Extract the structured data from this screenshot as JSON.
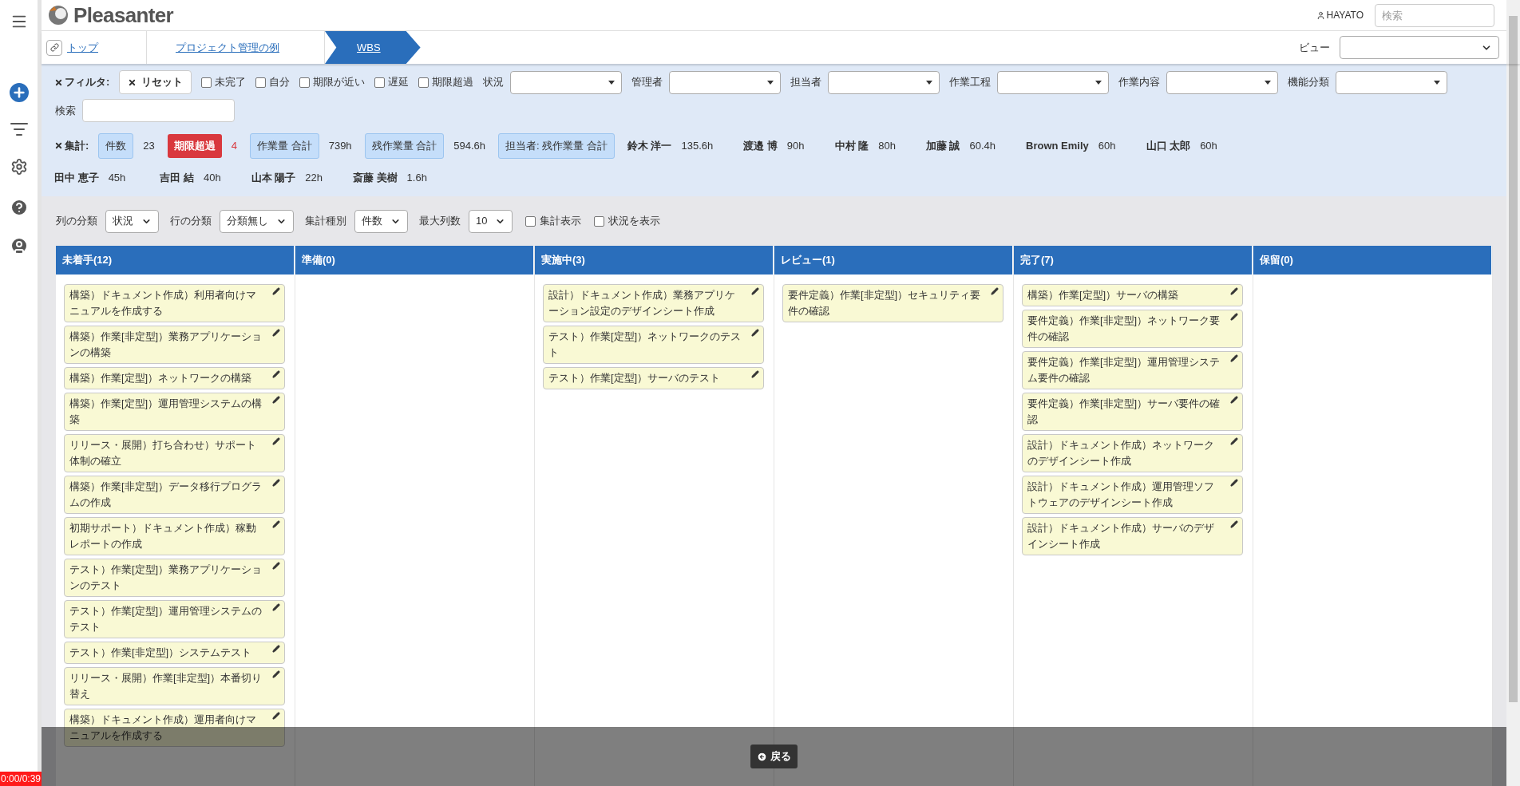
{
  "header": {
    "logo": "Pleasanter",
    "user": "HAYATO",
    "search_placeholder": "検索"
  },
  "breadcrumb": [
    {
      "label": "トップ",
      "selected": false
    },
    {
      "label": "プロジェクト管理の例",
      "selected": false
    },
    {
      "label": "WBS",
      "selected": true
    }
  ],
  "view": {
    "label": "ビュー"
  },
  "filters": {
    "label": "フィルタ:",
    "reset": "リセット",
    "checkboxes": [
      {
        "label": "未完了",
        "checked": false
      },
      {
        "label": "自分",
        "checked": false
      },
      {
        "label": "期限が近い",
        "checked": false
      },
      {
        "label": "遅延",
        "checked": false
      },
      {
        "label": "期限超過",
        "checked": false
      }
    ],
    "selects": [
      {
        "label": "状況"
      },
      {
        "label": "管理者"
      },
      {
        "label": "担当者"
      },
      {
        "label": "作業工程"
      },
      {
        "label": "作業内容"
      },
      {
        "label": "機能分類"
      }
    ],
    "search_label": "検索"
  },
  "summary": {
    "label": "集計:",
    "items": [
      {
        "kind": "chip",
        "label": "件数",
        "value": "23"
      },
      {
        "kind": "alert",
        "label": "期限超過",
        "value": "4"
      },
      {
        "kind": "chip",
        "label": "作業量 合計",
        "value": "739h"
      },
      {
        "kind": "chip",
        "label": "残作業量 合計",
        "value": "594.6h"
      },
      {
        "kind": "chip",
        "label": "担当者: 残作業量 合計"
      },
      {
        "kind": "person",
        "label": "鈴木 洋一",
        "value": "135.6h"
      },
      {
        "kind": "person",
        "label": "渡邉 博",
        "value": "90h"
      },
      {
        "kind": "person",
        "label": "中村 隆",
        "value": "80h"
      },
      {
        "kind": "person",
        "label": "加藤 誠",
        "value": "60.4h"
      },
      {
        "kind": "person",
        "label": "Brown Emily",
        "value": "60h"
      },
      {
        "kind": "person",
        "label": "山口 太郎",
        "value": "60h"
      },
      {
        "kind": "person",
        "label": "田中 恵子",
        "value": "45h"
      },
      {
        "kind": "person",
        "label": "吉田 結",
        "value": "40h"
      },
      {
        "kind": "person",
        "label": "山本 陽子",
        "value": "22h"
      },
      {
        "kind": "person",
        "label": "斎藤 美樹",
        "value": "1.6h"
      }
    ]
  },
  "options": [
    {
      "kind": "select",
      "label": "列の分類",
      "value": "状況"
    },
    {
      "kind": "select",
      "label": "行の分類",
      "value": "分類無し"
    },
    {
      "kind": "select",
      "label": "集計種別",
      "value": "件数"
    },
    {
      "kind": "select",
      "label": "最大列数",
      "value": "10"
    },
    {
      "kind": "checkbox",
      "label": "集計表示",
      "checked": false
    },
    {
      "kind": "checkbox",
      "label": "状況を表示",
      "checked": false
    }
  ],
  "columns": [
    {
      "title": "未着手(12)",
      "cards": [
        "構築）ドキュメント作成）利用者向けマニュアルを作成する",
        "構築）作業[非定型]）業務アプリケーションの構築",
        "構築）作業[定型]）ネットワークの構築",
        "構築）作業[定型]）運用管理システムの構築",
        "リリース・展開）打ち合わせ）サポート体制の確立",
        "構築）作業[非定型]）データ移行プログラムの作成",
        "初期サポート）ドキュメント作成）稼動レポートの作成",
        "テスト）作業[定型]）業務アプリケーションのテスト",
        "テスト）作業[定型]）運用管理システムのテスト",
        "テスト）作業[非定型]）システムテスト",
        "リリース・展開）作業[非定型]）本番切り替え",
        "構築）ドキュメント作成）運用者向けマニュアルを作成する"
      ]
    },
    {
      "title": "準備(0)"
    },
    {
      "title": "実施中(3)",
      "cards": [
        "設計）ドキュメント作成）業務アプリケーション設定のデザインシート作成",
        "テスト）作業[定型]）ネットワークのテスト",
        "テスト）作業[定型]）サーバのテスト"
      ]
    },
    {
      "title": "レビュー(1)",
      "cards": [
        "要件定義）作業[非定型]）セキュリティ要件の確認"
      ]
    },
    {
      "title": "完了(7)",
      "cards": [
        "構築）作業[定型]）サーバの構築",
        "要件定義）作業[非定型]）ネットワーク要件の確認",
        "要件定義）作業[非定型]）運用管理システム要件の確認",
        "要件定義）作業[非定型]）サーバ要件の確認",
        "設計）ドキュメント作成）ネットワークのデザインシート作成",
        "設計）ドキュメント作成）運用管理ソフトウェアのデザインシート作成",
        "設計）ドキュメント作成）サーバのデザインシート作成"
      ]
    },
    {
      "title": "保留(0)"
    }
  ],
  "back_button": "戻る",
  "timer": "0:00/0:39"
}
